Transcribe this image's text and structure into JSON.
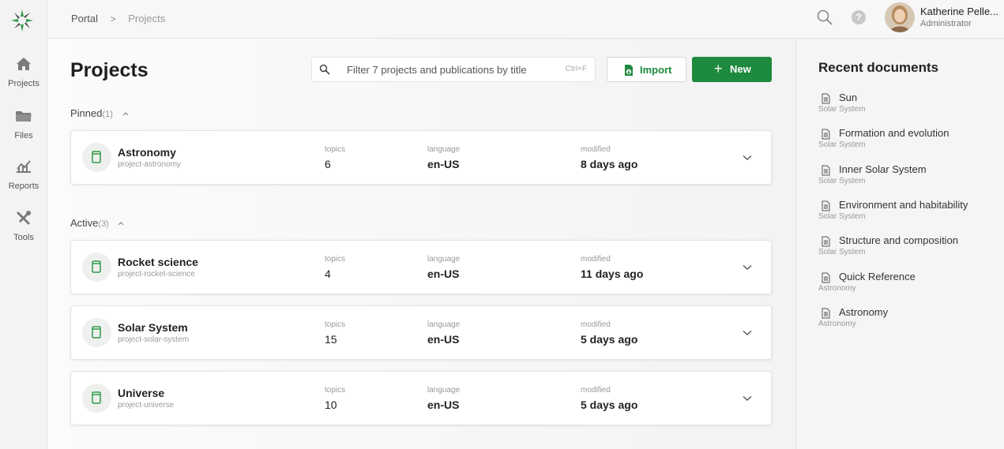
{
  "nav": {
    "items": [
      {
        "label": "Projects",
        "icon": "home-icon"
      },
      {
        "label": "Files",
        "icon": "folder-icon"
      },
      {
        "label": "Reports",
        "icon": "chart-icon"
      },
      {
        "label": "Tools",
        "icon": "tools-icon"
      }
    ]
  },
  "breadcrumb": {
    "root": "Portal",
    "separator": ">",
    "current": "Projects"
  },
  "user": {
    "name": "Katherine Pelle...",
    "role": "Administrator"
  },
  "help": {
    "label": "?"
  },
  "page": {
    "title": "Projects"
  },
  "search": {
    "placeholder": "Filter 7 projects and publications by title",
    "shortcut": "Ctrl+F"
  },
  "actions": {
    "import_label": "Import",
    "new_label": "New",
    "new_icon": "+"
  },
  "sections": [
    {
      "label": "Pinned",
      "count": "(1)"
    },
    {
      "label": "Active",
      "count": "(3)"
    }
  ],
  "fields": {
    "topics": "topics",
    "language": "language",
    "modified": "modified"
  },
  "projects": [
    {
      "name": "Astronomy",
      "slug": "project-astronomy",
      "topics": "6",
      "language": "en-US",
      "modified": "8 days ago"
    },
    {
      "name": "Rocket science",
      "slug": "project-rocket-science",
      "topics": "4",
      "language": "en-US",
      "modified": "11 days ago"
    },
    {
      "name": "Solar System",
      "slug": "project-solar-system",
      "topics": "15",
      "language": "en-US",
      "modified": "5 days ago"
    },
    {
      "name": "Universe",
      "slug": "project-universe",
      "topics": "10",
      "language": "en-US",
      "modified": "5 days ago"
    }
  ],
  "recent": {
    "title": "Recent documents",
    "items": [
      {
        "title": "Sun",
        "project": "Solar System"
      },
      {
        "title": "Formation and evolution",
        "project": "Solar System"
      },
      {
        "title": "Inner Solar System",
        "project": "Solar System"
      },
      {
        "title": "Environment and habitability",
        "project": "Solar System"
      },
      {
        "title": "Structure and composition",
        "project": "Solar System"
      },
      {
        "title": "Quick Reference",
        "project": "Astronomy"
      },
      {
        "title": "Astronomy",
        "project": "Astronomy"
      }
    ]
  },
  "colors": {
    "accent": "#1e8a3e",
    "project_icon": "#2e9a4a"
  }
}
